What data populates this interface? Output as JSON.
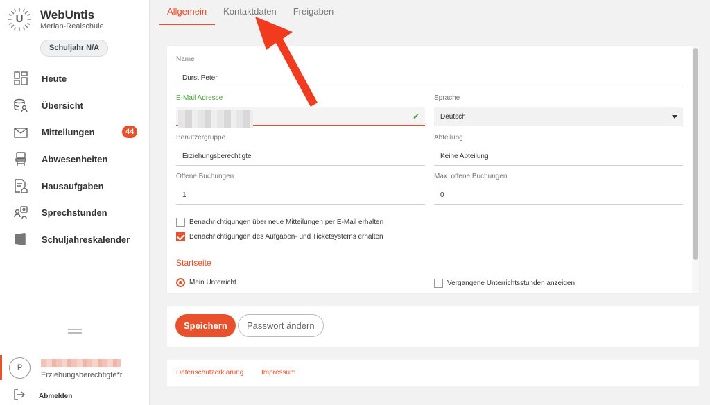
{
  "brand": {
    "logo_letter": "U",
    "title": "WebUntis",
    "school": "Merian-Realschule"
  },
  "school_year_button": "Schuljahr N/A",
  "nav": {
    "items": [
      {
        "label": "Heute",
        "icon": "dashboard-icon"
      },
      {
        "label": "Übersicht",
        "icon": "database-user-icon"
      },
      {
        "label": "Mitteilungen",
        "icon": "mail-icon",
        "badge": "44"
      },
      {
        "label": "Abwesenheiten",
        "icon": "chair-icon"
      },
      {
        "label": "Hausaufgaben",
        "icon": "homework-icon"
      },
      {
        "label": "Sprechstunden",
        "icon": "consultation-icon"
      },
      {
        "label": "Schuljahreskalender",
        "icon": "calendar-book-icon"
      }
    ]
  },
  "user": {
    "avatar_letter": "P",
    "role": "Erziehungsberechtigte*r"
  },
  "logout_label": "Abmelden",
  "tabs": [
    {
      "label": "Allgemein",
      "active": true
    },
    {
      "label": "Kontaktdaten",
      "active": false
    },
    {
      "label": "Freigaben",
      "active": false
    }
  ],
  "form": {
    "name": {
      "label": "Name",
      "value": "Durst Peter"
    },
    "email": {
      "label": "E-Mail Adresse",
      "value": ""
    },
    "language": {
      "label": "Sprache",
      "value": "Deutsch"
    },
    "user_group": {
      "label": "Benutzergruppe",
      "value": "Erziehungsberechtigte"
    },
    "department": {
      "label": "Abteilung",
      "value": "Keine Abteilung"
    },
    "open_bookings": {
      "label": "Offene Buchungen",
      "value": "1"
    },
    "max_open_bookings": {
      "label": "Max. offene Buchungen",
      "value": "0"
    },
    "notify_messages": {
      "label": "Benachrichtigungen über neue Mitteilungen per E-Mail erhalten",
      "checked": false
    },
    "notify_tasks": {
      "label": "Benachrichtigungen des Aufgaben- und Ticketsystems erhalten",
      "checked": true
    },
    "start_page_title": "Startseite",
    "start_page_option": "Mein Unterricht",
    "past_lessons": {
      "label": "Vergangene Unterrichtsstunden anzeigen",
      "checked": false
    }
  },
  "actions": {
    "save": "Speichern",
    "change_password": "Passwort ändern"
  },
  "footer": {
    "privacy": "Datenschutzerklärung",
    "imprint": "Impressum"
  },
  "colors": {
    "accent": "#e8512c",
    "success": "#4a9d3a"
  }
}
